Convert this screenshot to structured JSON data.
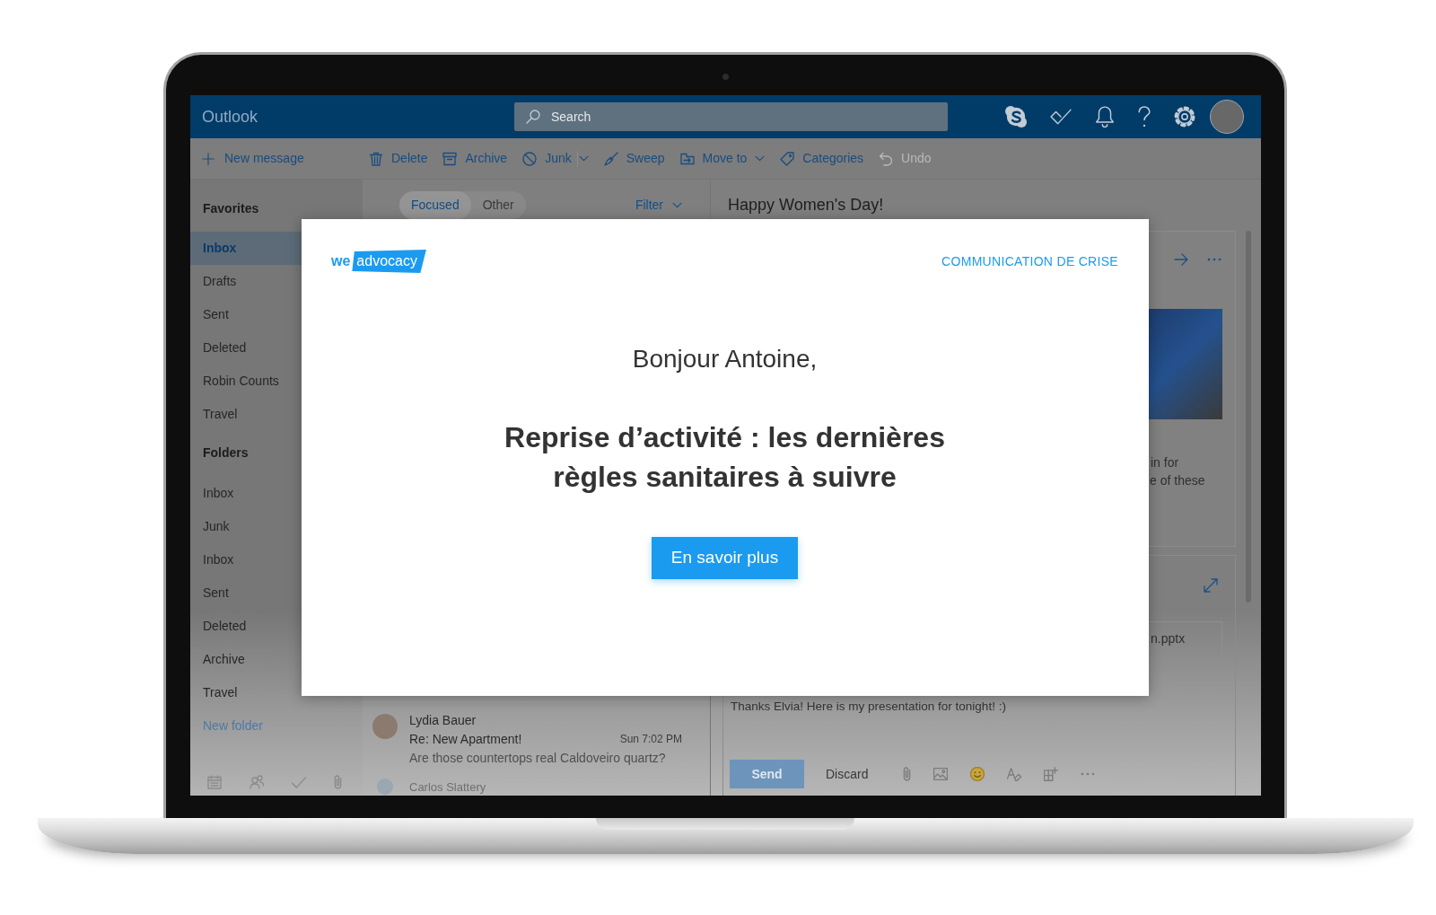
{
  "app": {
    "title": "Outlook",
    "search": {
      "placeholder": "Search"
    }
  },
  "toolbar": [
    {
      "label": "New message",
      "dropdown": false,
      "split": false,
      "disabled": false
    },
    {
      "label": "Delete",
      "dropdown": false,
      "split": false,
      "disabled": false
    },
    {
      "label": "Archive",
      "dropdown": false,
      "split": false,
      "disabled": false
    },
    {
      "label": "Junk",
      "dropdown": true,
      "split": true,
      "disabled": false
    },
    {
      "label": "Sweep",
      "dropdown": false,
      "split": false,
      "disabled": false
    },
    {
      "label": "Move to",
      "dropdown": true,
      "split": false,
      "disabled": false
    },
    {
      "label": "Categories",
      "dropdown": false,
      "split": false,
      "disabled": false
    },
    {
      "label": "Undo",
      "dropdown": false,
      "split": false,
      "disabled": true
    }
  ],
  "sidebar": {
    "sections": [
      {
        "title": "Favorites",
        "items": [
          {
            "label": "Inbox",
            "selected": true
          },
          {
            "label": "Drafts",
            "selected": false
          },
          {
            "label": "Sent",
            "selected": false
          },
          {
            "label": "Deleted",
            "selected": false
          },
          {
            "label": "Robin Counts",
            "selected": false
          },
          {
            "label": "Travel",
            "selected": false
          }
        ]
      },
      {
        "title": "Folders",
        "items": [
          {
            "label": "Inbox",
            "selected": false
          },
          {
            "label": "Junk",
            "selected": false
          },
          {
            "label": "Inbox",
            "selected": false
          },
          {
            "label": "Sent",
            "selected": false
          },
          {
            "label": "Deleted",
            "selected": false
          },
          {
            "label": "Archive",
            "selected": false
          },
          {
            "label": "Travel",
            "selected": false
          }
        ]
      }
    ],
    "new_folder": "New folder"
  },
  "message_list": {
    "tabs": [
      {
        "label": "Focused",
        "selected": true
      },
      {
        "label": "Other",
        "selected": false
      }
    ],
    "filter": "Filter",
    "messages": [
      {
        "sender": "Lydia Bauer",
        "subject": "Re: New Apartment!",
        "time": "Sun 7:02 PM",
        "preview": "Are those countertops real Caldoveiro quartz?"
      },
      {
        "sender": "Carlos Slattery"
      }
    ]
  },
  "reading_pane": {
    "subject": "Happy Women's Day!",
    "body_fragments": [
      "in for",
      "e of these"
    ],
    "attachment": "n.pptx",
    "reply_text": "Thanks Elvia! Here is my presentation for tonight! :)",
    "send": "Send",
    "discard": "Discard"
  },
  "modal": {
    "logo": {
      "prefix": "we",
      "tag": "advocacy"
    },
    "category": "COMMUNICATION DE CRISE",
    "greeting": "Bonjour Antoine,",
    "headline": "Reprise d’activité : les dernières règles sanitaires à suivre",
    "button": "En savoir plus"
  }
}
